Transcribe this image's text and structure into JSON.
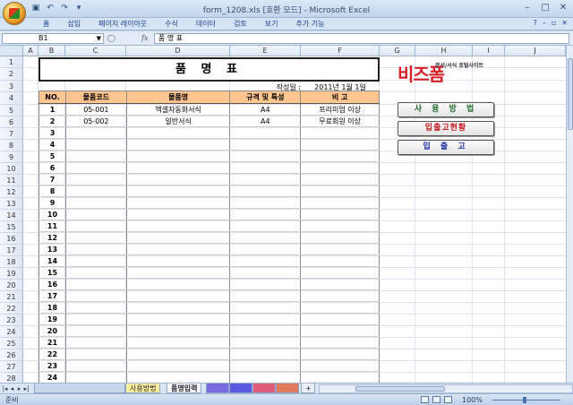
{
  "window": {
    "title": "form_1208.xls  [호환 모드] - Microsoft Excel"
  },
  "menu": {
    "tabs": [
      "홈",
      "삽입",
      "페이지 레이아웃",
      "수식",
      "데이터",
      "검토",
      "보기",
      "추가 기능"
    ]
  },
  "formula_bar": {
    "cell_ref": "B1",
    "fx": "fx",
    "content": "품 명 표"
  },
  "columns": [
    "A",
    "B",
    "C",
    "D",
    "E",
    "F",
    "G",
    "H",
    "I",
    "J"
  ],
  "rows": [
    "1",
    "2",
    "3",
    "4",
    "5",
    "6",
    "7",
    "8",
    "9",
    "10",
    "11",
    "12",
    "13",
    "14",
    "15",
    "16",
    "17",
    "18",
    "19",
    "20",
    "21",
    "22",
    "23",
    "24",
    "25",
    "26",
    "27",
    "28"
  ],
  "sheet": {
    "title": "품 명 표",
    "date_label": "작성일 :",
    "date_value": "2011년 1월 1일",
    "headers": [
      "NO.",
      "물품코드",
      "물품명",
      "규격 및 특성",
      "비  고"
    ],
    "items": [
      {
        "no": "1",
        "code": "05-001",
        "name": "엑셀자동화서식",
        "spec": "A4",
        "note": "프리미엄 이상"
      },
      {
        "no": "2",
        "code": "05-002",
        "name": "일반서식",
        "spec": "A4",
        "note": "무료회원 이상"
      },
      {
        "no": "3",
        "code": "",
        "name": "",
        "spec": "",
        "note": ""
      },
      {
        "no": "4",
        "code": "",
        "name": "",
        "spec": "",
        "note": ""
      },
      {
        "no": "5",
        "code": "",
        "name": "",
        "spec": "",
        "note": ""
      },
      {
        "no": "6",
        "code": "",
        "name": "",
        "spec": "",
        "note": ""
      },
      {
        "no": "7",
        "code": "",
        "name": "",
        "spec": "",
        "note": ""
      },
      {
        "no": "8",
        "code": "",
        "name": "",
        "spec": "",
        "note": ""
      },
      {
        "no": "9",
        "code": "",
        "name": "",
        "spec": "",
        "note": ""
      },
      {
        "no": "10",
        "code": "",
        "name": "",
        "spec": "",
        "note": ""
      },
      {
        "no": "11",
        "code": "",
        "name": "",
        "spec": "",
        "note": ""
      },
      {
        "no": "12",
        "code": "",
        "name": "",
        "spec": "",
        "note": ""
      },
      {
        "no": "13",
        "code": "",
        "name": "",
        "spec": "",
        "note": ""
      },
      {
        "no": "14",
        "code": "",
        "name": "",
        "spec": "",
        "note": ""
      },
      {
        "no": "15",
        "code": "",
        "name": "",
        "spec": "",
        "note": ""
      },
      {
        "no": "16",
        "code": "",
        "name": "",
        "spec": "",
        "note": ""
      },
      {
        "no": "17",
        "code": "",
        "name": "",
        "spec": "",
        "note": ""
      },
      {
        "no": "18",
        "code": "",
        "name": "",
        "spec": "",
        "note": ""
      },
      {
        "no": "19",
        "code": "",
        "name": "",
        "spec": "",
        "note": ""
      },
      {
        "no": "20",
        "code": "",
        "name": "",
        "spec": "",
        "note": ""
      },
      {
        "no": "21",
        "code": "",
        "name": "",
        "spec": "",
        "note": ""
      },
      {
        "no": "22",
        "code": "",
        "name": "",
        "spec": "",
        "note": ""
      },
      {
        "no": "23",
        "code": "",
        "name": "",
        "spec": "",
        "note": ""
      },
      {
        "no": "24",
        "code": "",
        "name": "",
        "spec": "",
        "note": ""
      }
    ]
  },
  "logo": {
    "text": "비즈폼",
    "tagline": "문서/서식 포털사이트",
    "color": "#d81f26"
  },
  "buttons": {
    "usage": "사 용 방 법",
    "inout_status": "입출고현황",
    "inout": "입 출 고"
  },
  "sheet_tabs": {
    "usage": "사용방법",
    "item_entry": "품명입력"
  },
  "status": {
    "ready": "준비",
    "zoom": "100%"
  }
}
